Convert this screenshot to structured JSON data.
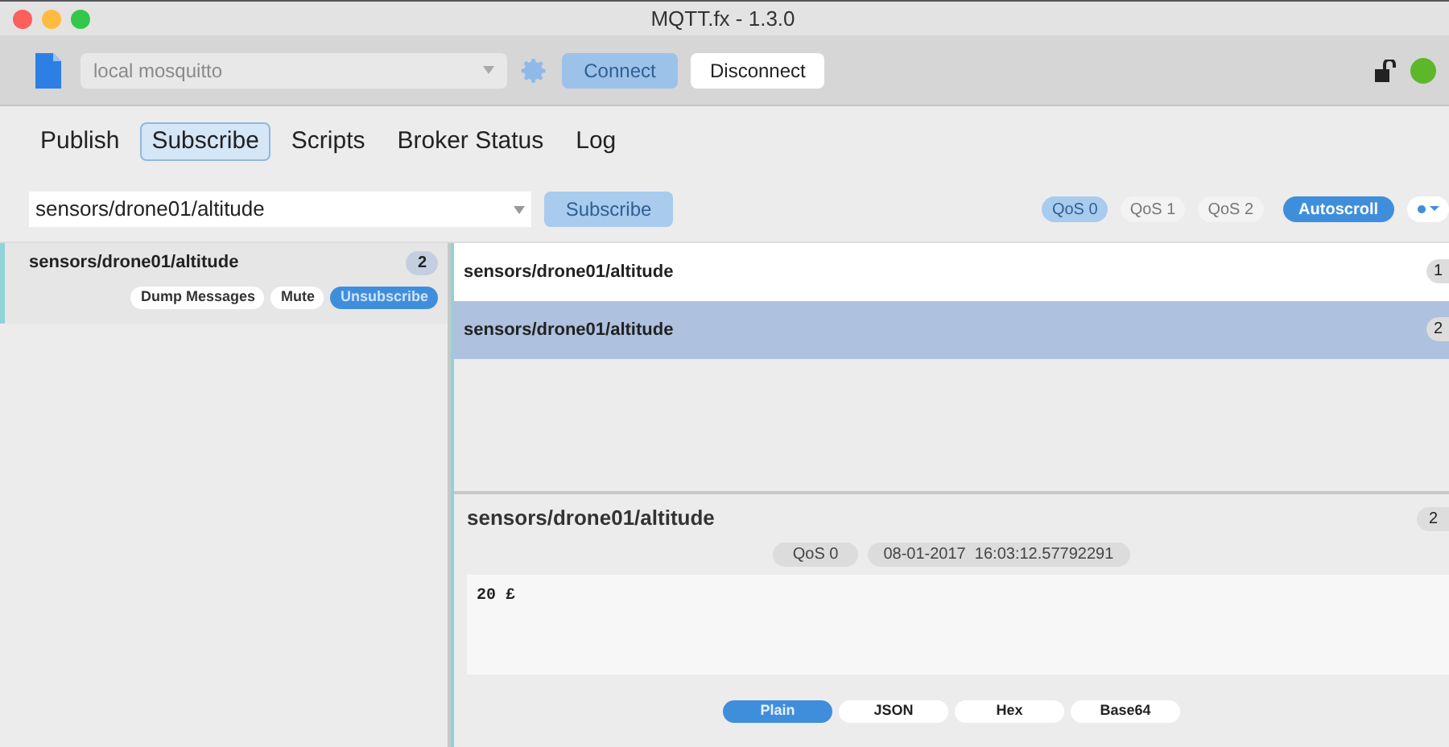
{
  "window": {
    "title": "MQTT.fx - 1.3.0"
  },
  "toolbar": {
    "profile": {
      "value": "local mosquitto",
      "disabled": true
    },
    "connect": {
      "label": "Connect",
      "disabled": true
    },
    "disconnect": {
      "label": "Disconnect",
      "disabled": false
    },
    "connected": true
  },
  "tabs": [
    {
      "label": "Publish",
      "selected": false
    },
    {
      "label": "Subscribe",
      "selected": true
    },
    {
      "label": "Scripts",
      "selected": false
    },
    {
      "label": "Broker Status",
      "selected": false
    },
    {
      "label": "Log",
      "selected": false
    }
  ],
  "subscribe_bar": {
    "topic": "sensors/drone01/altitude",
    "button": {
      "label": "Subscribe",
      "disabled": true
    },
    "qos": [
      {
        "label": "QoS 0",
        "selected": true
      },
      {
        "label": "QoS 1",
        "selected": false
      },
      {
        "label": "QoS 2",
        "selected": false
      }
    ],
    "autoscroll": {
      "label": "Autoscroll",
      "on": true
    }
  },
  "subscriptions": [
    {
      "topic": "sensors/drone01/altitude",
      "count": "2",
      "buttons": [
        {
          "label": "Dump Messages",
          "kind": "plain"
        },
        {
          "label": "Mute",
          "kind": "plain"
        },
        {
          "label": "Unsubscribe",
          "kind": "primary"
        }
      ]
    }
  ],
  "messages": [
    {
      "topic": "sensors/drone01/altitude",
      "count": "1",
      "selected": false
    },
    {
      "topic": "sensors/drone01/altitude",
      "count": "2",
      "selected": true
    }
  ],
  "detail": {
    "topic": "sensors/drone01/altitude",
    "count": "2",
    "qos": "QoS 0",
    "timestamp": "08-01-2017  16:03:12.57792291",
    "payload": "20 £",
    "formats": [
      {
        "label": "Plain",
        "selected": true
      },
      {
        "label": "JSON",
        "selected": false
      },
      {
        "label": "Hex",
        "selected": false
      },
      {
        "label": "Base64",
        "selected": false
      }
    ]
  }
}
